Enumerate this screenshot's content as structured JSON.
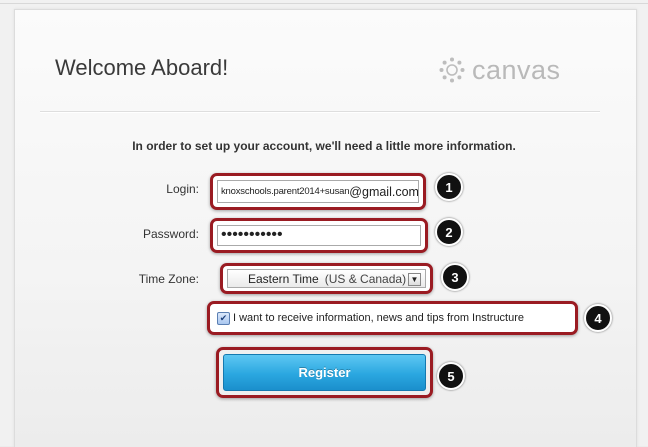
{
  "header": {
    "title": "Welcome Aboard!",
    "brand": "canvas",
    "brand_icon": "canvas-logo-icon"
  },
  "intro": "In order to set up your account, we'll need a little more information.",
  "form": {
    "login_label": "Login:",
    "login_value_prefix": "knoxschools.parent2014+susan",
    "login_value_suffix": "@gmail.com",
    "password_label": "Password:",
    "password_value": "•••••••••••",
    "timezone_label": "Time Zone:",
    "timezone_value": "Eastern Time",
    "timezone_value_detail": "(US & Canada)",
    "newsletter_checked": true,
    "newsletter_label": "I want to receive information, news and tips from Instructure",
    "register_label": "Register"
  },
  "annotations": [
    "1",
    "2",
    "3",
    "4",
    "5"
  ],
  "colors": {
    "highlight": "#9a1b22",
    "button": "#2aa7e0",
    "badge": "#111111"
  }
}
